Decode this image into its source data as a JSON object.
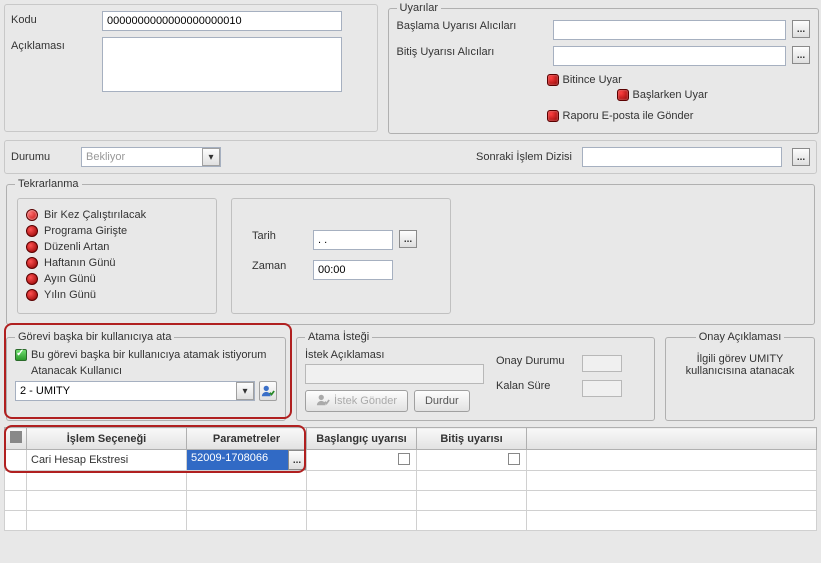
{
  "top": {
    "kodu_label": "Kodu",
    "kodu_value": "0000000000000000000010",
    "aciklamasi_label": "Açıklaması",
    "aciklamasi_value": ""
  },
  "uyarilar": {
    "legend": "Uyarılar",
    "baslama_label": "Başlama Uyarısı Alıcıları",
    "bitis_label": "Bitiş Uyarısı Alıcıları",
    "bitince_uyar": "Bitince Uyar",
    "baslarken_uyar": "Başlarken Uyar",
    "raporu_eposta": "Raporu E-posta ile Gönder"
  },
  "durumu": {
    "label": "Durumu",
    "value": "Bekliyor",
    "sonraki_label": "Sonraki İşlem Dizisi"
  },
  "tekrarlanma": {
    "legend": "Tekrarlanma",
    "options": [
      "Bir Kez Çalıştırılacak",
      "Programa Girişte",
      "Düzenli Artan",
      "Haftanın Günü",
      "Ayın Günü",
      "Yılın Günü"
    ],
    "selected": 0,
    "tarih_label": "Tarih",
    "tarih_value": ". .",
    "zaman_label": "Zaman",
    "zaman_value": "00:00"
  },
  "assign": {
    "legend": "Görevi başka bir kullanıcıya ata",
    "check_label": "Bu görevi başka bir kullanıcıya atamak istiyorum",
    "user_label": "Atanacak Kullanıcı",
    "user_value": "2 - UMITY"
  },
  "atama": {
    "legend": "Atama İsteği",
    "istek_label": "İstek Açıklaması",
    "gonder_btn": "İstek Gönder",
    "durdur_btn": "Durdur",
    "onay_label": "Onay Durumu",
    "kalan_label": "Kalan Süre"
  },
  "onay": {
    "legend": "Onay Açıklaması",
    "text": "İlgili görev UMITY kullanıcısına atanacak"
  },
  "grid": {
    "headers": [
      "İşlem Seçeneği",
      "Parametreler",
      "Başlangıç uyarısı",
      "Bitiş uyarısı"
    ],
    "row0": {
      "islem": "Cari Hesap Ekstresi",
      "param": "52009-1708066"
    }
  }
}
